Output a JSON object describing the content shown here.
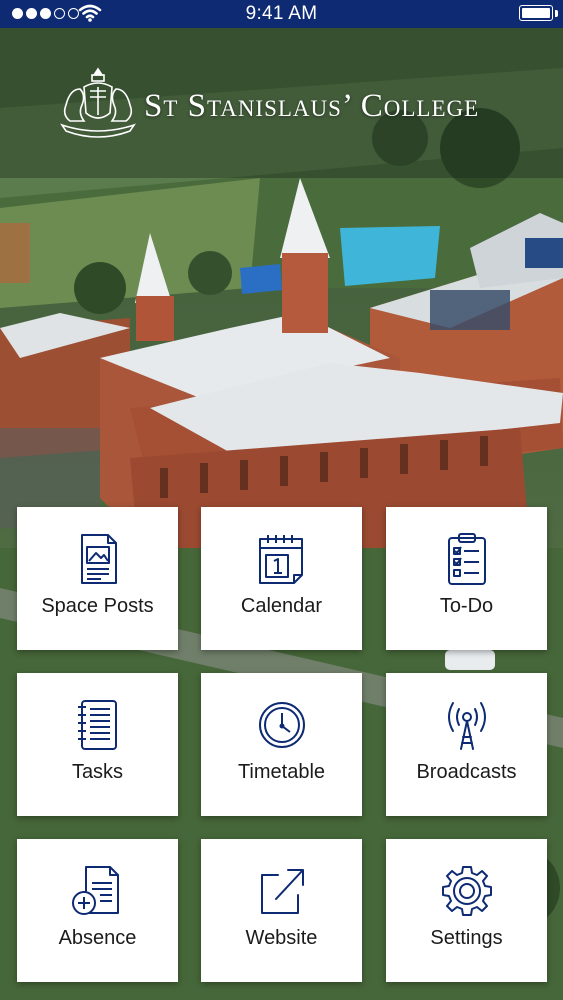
{
  "status_bar": {
    "time": "9:41 AM",
    "signal_bars": 5,
    "signal_filled": 3,
    "battery_level": 1.0,
    "icons": [
      "signal-dots-icon",
      "wifi-icon",
      "battery-icon"
    ]
  },
  "header": {
    "title": "St Stanislaus’ College",
    "logo": "college-crest-logo"
  },
  "colors": {
    "status_bar": "#0d2a73",
    "icon_stroke": "#0d2a73",
    "tile_bg": "#ffffff",
    "label_text": "#1b1b1b"
  },
  "tiles": [
    {
      "label": "Space Posts",
      "icon": "space-posts-icon"
    },
    {
      "label": "Calendar",
      "icon": "calendar-icon"
    },
    {
      "label": "To-Do",
      "icon": "todo-clipboard-icon"
    },
    {
      "label": "Tasks",
      "icon": "tasks-notebook-icon"
    },
    {
      "label": "Timetable",
      "icon": "clock-icon"
    },
    {
      "label": "Broadcasts",
      "icon": "broadcast-tower-icon"
    },
    {
      "label": "Absence",
      "icon": "absence-form-icon"
    },
    {
      "label": "Website",
      "icon": "external-link-icon"
    },
    {
      "label": "Settings",
      "icon": "gear-icon"
    }
  ]
}
